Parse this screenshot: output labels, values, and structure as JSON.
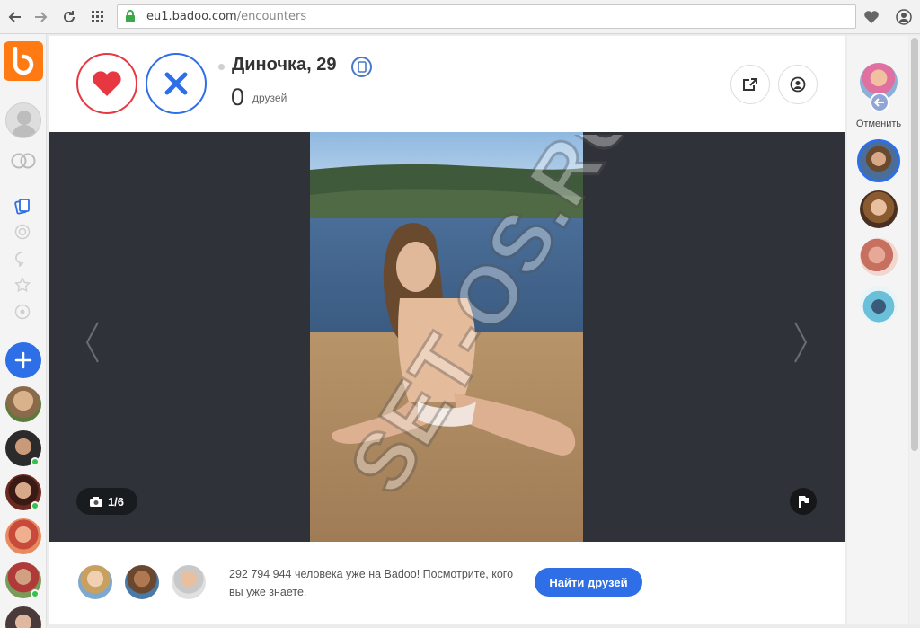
{
  "browser": {
    "url_host": "eu1.badoo.com",
    "url_path": "/encounters"
  },
  "profile": {
    "name": "Диночка, 29",
    "friends_count": "0",
    "friends_label": "друзей"
  },
  "photo": {
    "counter": "1/6"
  },
  "promo": {
    "text": "292 794 944 человека уже на Badoo! Посмотрите, кого вы уже знаете.",
    "button_label": "Найти друзей"
  },
  "right_sidebar": {
    "undo_label": "Отменить"
  },
  "colors": {
    "brand_orange": "#ff7a12",
    "like_red": "#e73842",
    "accent_blue": "#2e6ee6",
    "photo_bg": "#2f3339"
  }
}
